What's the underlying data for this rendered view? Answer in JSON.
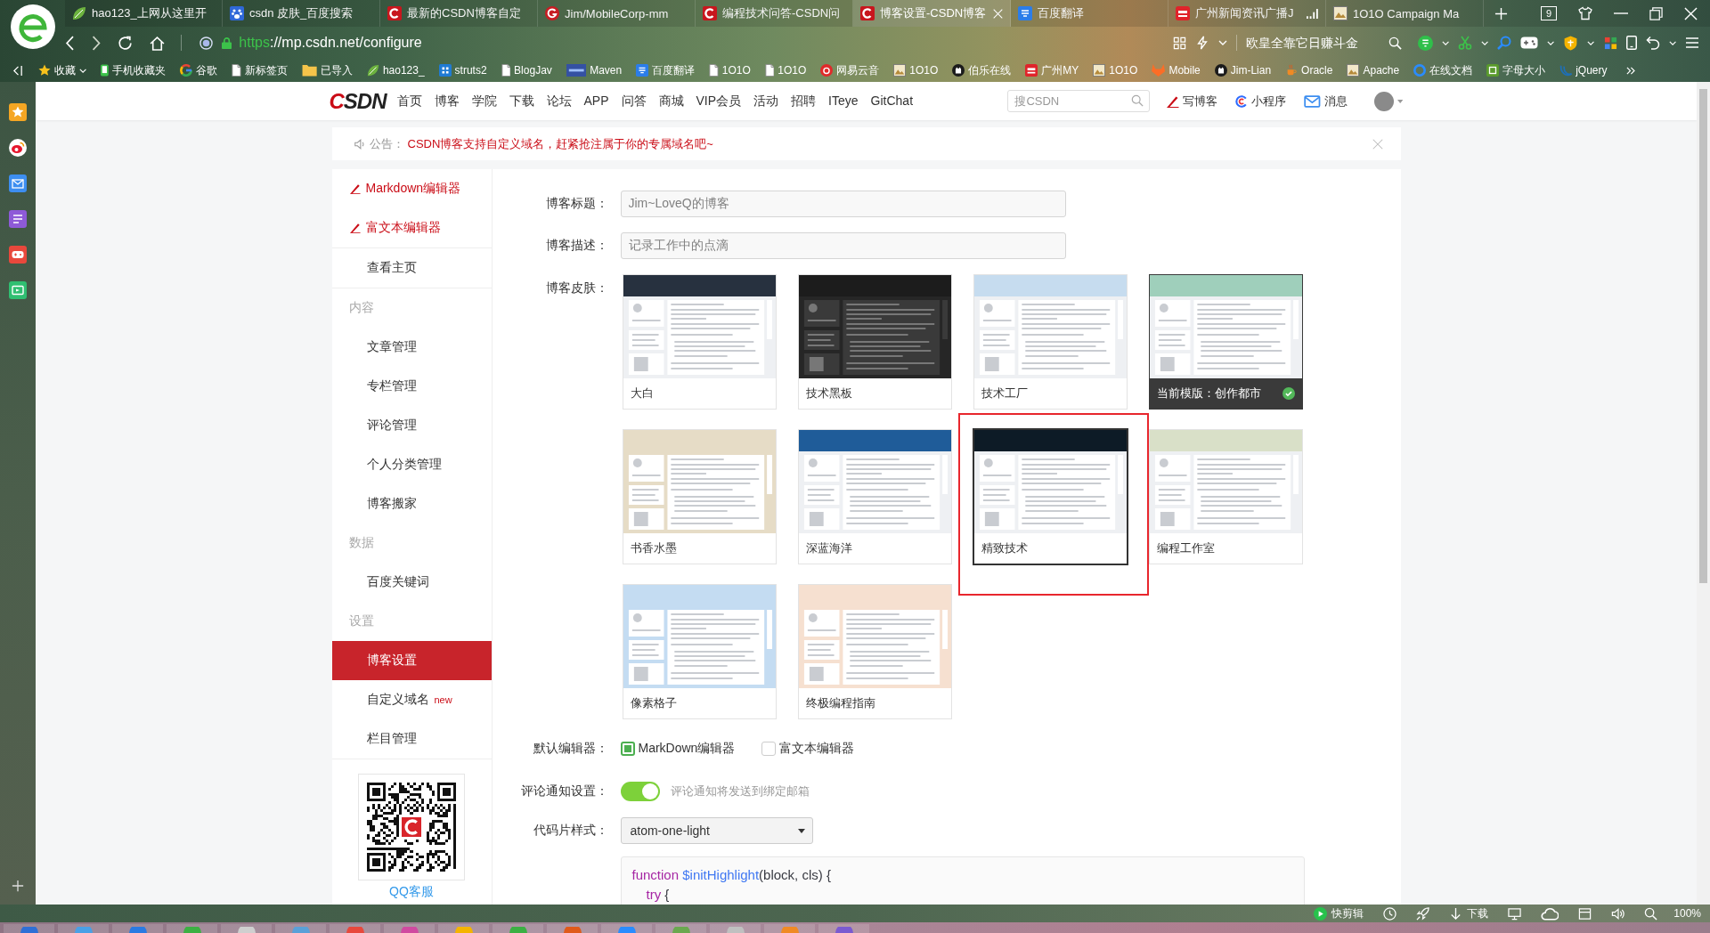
{
  "browser": {
    "tabs": [
      {
        "kind": "leaf",
        "title": "hao123_上网从这里开",
        "selected": false,
        "audio": false
      },
      {
        "kind": "paw",
        "title": "csdn 皮肤_百度搜索",
        "selected": false,
        "audio": false
      },
      {
        "kind": "c",
        "title": "最新的CSDN博客自定",
        "selected": false,
        "audio": false
      },
      {
        "kind": "g",
        "title": "Jim/MobileCorp-mm",
        "selected": false,
        "audio": false
      },
      {
        "kind": "c",
        "title": "编程技术问答-CSDN问",
        "selected": false,
        "audio": false
      },
      {
        "kind": "c",
        "title": "博客设置-CSDN博客",
        "selected": true,
        "audio": false
      },
      {
        "kind": "tile",
        "title": "百度翻译",
        "selected": false,
        "audio": false
      },
      {
        "kind": "radio",
        "title": "广州新闻资讯广播J",
        "selected": false,
        "audio": true
      },
      {
        "kind": "picture",
        "title": "1O1O Campaign Ma",
        "selected": false,
        "audio": false
      }
    ],
    "tab_counter": "9",
    "address": {
      "scheme": "https",
      "rest": "://mp.csdn.net/configure"
    },
    "search_placeholder": "欧皇全靠它日赚斗金",
    "bookmarks": [
      {
        "kind": "star",
        "label": "收藏",
        "dropdown": true
      },
      {
        "kind": "phone",
        "label": "手机收藏夹",
        "dropdown": false
      },
      {
        "kind": "google",
        "label": "谷歌",
        "dropdown": false
      },
      {
        "kind": "page",
        "label": "新标签页",
        "dropdown": false
      },
      {
        "kind": "folder",
        "label": "已导入",
        "dropdown": false
      },
      {
        "kind": "leaf",
        "label": "hao123_",
        "dropdown": false
      },
      {
        "kind": "grid",
        "label": "struts2",
        "dropdown": false
      },
      {
        "kind": "page",
        "label": "BlogJav",
        "dropdown": false
      },
      {
        "kind": "banner",
        "label": "Maven",
        "dropdown": false
      },
      {
        "kind": "tile",
        "label": "百度翻译",
        "dropdown": false
      },
      {
        "kind": "page",
        "label": "1O1O",
        "dropdown": false
      },
      {
        "kind": "page",
        "label": "1O1O",
        "dropdown": false
      },
      {
        "kind": "disc",
        "label": "网易云音",
        "dropdown": false
      },
      {
        "kind": "picture",
        "label": "1O1O",
        "dropdown": false
      },
      {
        "kind": "cat",
        "label": "伯乐在线",
        "dropdown": false
      },
      {
        "kind": "radio",
        "label": "广州MY",
        "dropdown": false
      },
      {
        "kind": "picture",
        "label": "1O1O",
        "dropdown": false
      },
      {
        "kind": "fox",
        "label": "Mobile",
        "dropdown": false
      },
      {
        "kind": "cat",
        "label": "Jim-Lian",
        "dropdown": false
      },
      {
        "kind": "cup",
        "label": "Oracle",
        "dropdown": false
      },
      {
        "kind": "picture",
        "label": "Apache",
        "dropdown": false
      },
      {
        "kind": "ring",
        "label": "在线文档",
        "dropdown": false
      },
      {
        "kind": "square",
        "label": "字母大小",
        "dropdown": false
      },
      {
        "kind": "swirl",
        "label": "jQuery",
        "dropdown": false
      }
    ]
  },
  "site_header": {
    "logo": "CSDN",
    "nav": [
      "首页",
      "博客",
      "学院",
      "下载",
      "论坛",
      "APP",
      "问答",
      "商城",
      "VIP会员",
      "活动",
      "招聘",
      "ITeye",
      "GitChat"
    ],
    "search_placeholder": "搜CSDN",
    "actions": [
      {
        "kind": "pen",
        "label": "写博客"
      },
      {
        "kind": "mini",
        "label": "小程序"
      },
      {
        "kind": "mail",
        "label": "消息"
      }
    ]
  },
  "notice": {
    "label": "公告：",
    "text": "CSDN博客支持自定义域名，赶紧抢注属于你的专属域名吧~"
  },
  "sidebar": {
    "groups": [
      [
        {
          "kind": "editor",
          "label": "Markdown编辑器",
          "selected": false
        },
        {
          "kind": "editor",
          "label": "富文本编辑器",
          "selected": false
        }
      ],
      [
        {
          "kind": "link",
          "label": "查看主页",
          "selected": false
        }
      ],
      [
        {
          "kind": "section",
          "label": "内容",
          "selected": false
        },
        {
          "kind": "link",
          "label": "文章管理",
          "selected": false
        },
        {
          "kind": "link",
          "label": "专栏管理",
          "selected": false
        },
        {
          "kind": "link",
          "label": "评论管理",
          "selected": false
        },
        {
          "kind": "link",
          "label": "个人分类管理",
          "selected": false
        },
        {
          "kind": "link",
          "label": "博客搬家",
          "selected": false
        },
        {
          "kind": "section",
          "label": "数据",
          "selected": false
        },
        {
          "kind": "link",
          "label": "百度关键词",
          "selected": false
        },
        {
          "kind": "section",
          "label": "设置",
          "selected": false
        },
        {
          "kind": "link",
          "label": "博客设置",
          "selected": true
        },
        {
          "kind": "link",
          "label": "自定义域名",
          "badge": "new",
          "selected": false
        },
        {
          "kind": "link",
          "label": "栏目管理",
          "selected": false
        }
      ]
    ],
    "qr_caption": "QQ客服"
  },
  "settings": {
    "fields": [
      {
        "label": "博客标题：",
        "value": "Jim~LoveQ的博客"
      },
      {
        "label": "博客描述：",
        "value": "记录工作中的点滴"
      }
    ],
    "skins": {
      "label": "博客皮肤：",
      "items": [
        {
          "name": "大白",
          "color": "#27313f",
          "kind": "light",
          "current": false,
          "selected": false
        },
        {
          "name": "技术黑板",
          "color": "#1c1c1c",
          "kind": "dark",
          "current": false,
          "selected": false
        },
        {
          "name": "技术工厂",
          "color": "#c6dcef",
          "kind": "light",
          "current": false,
          "selected": false
        },
        {
          "name": "当前模版：创作都市",
          "color": "#9fcfbb",
          "kind": "light",
          "current": true,
          "selected": false
        },
        {
          "name": "书香水墨",
          "color": "#e6dcc6",
          "kind": "tinted",
          "current": false,
          "selected": false
        },
        {
          "name": "深蓝海洋",
          "color": "#1f5c99",
          "kind": "light",
          "current": false,
          "selected": false
        },
        {
          "name": "精致技术",
          "color": "#0d1b26",
          "kind": "light",
          "current": false,
          "selected": true
        },
        {
          "name": "编程工作室",
          "color": "#d9e0c8",
          "kind": "light",
          "current": false,
          "selected": false
        },
        {
          "name": "像素格子",
          "color": "#c4dcf2",
          "kind": "tinted",
          "current": false,
          "selected": false
        },
        {
          "name": "终极编程指南",
          "color": "#f6e0d0",
          "kind": "tinted",
          "current": false,
          "selected": false
        }
      ]
    },
    "default_editor": {
      "label": "默认编辑器：",
      "options": [
        {
          "label": "MarkDown编辑器",
          "selected": true
        },
        {
          "label": "富文本编辑器",
          "selected": false
        }
      ]
    },
    "comment_notice": {
      "label": "评论通知设置：",
      "on": true,
      "hint": "评论通知将发送到绑定邮箱"
    },
    "code_style": {
      "label": "代码片样式：",
      "value": "atom-one-light"
    },
    "code_sample": {
      "lines": [
        {
          "indented": false,
          "tokens": [
            {
              "kind": "keyword",
              "text": "function "
            },
            {
              "kind": "title",
              "text": "$initHighlight"
            },
            {
              "kind": "plain",
              "text": "(block, cls) {"
            }
          ]
        },
        {
          "indented": true,
          "tokens": [
            {
              "kind": "keyword",
              "text": "try"
            },
            {
              "kind": "plain",
              "text": " {"
            }
          ]
        }
      ]
    }
  },
  "status_bar": {
    "items": [
      {
        "kind": "play",
        "label": "快剪辑"
      },
      {
        "kind": "clock"
      },
      {
        "kind": "rocket"
      },
      {
        "kind": "download",
        "label": "下载"
      },
      {
        "kind": "screen"
      },
      {
        "kind": "cloud"
      },
      {
        "kind": "window"
      },
      {
        "kind": "sound"
      },
      {
        "kind": "zoom"
      }
    ],
    "zoom": "100%"
  }
}
